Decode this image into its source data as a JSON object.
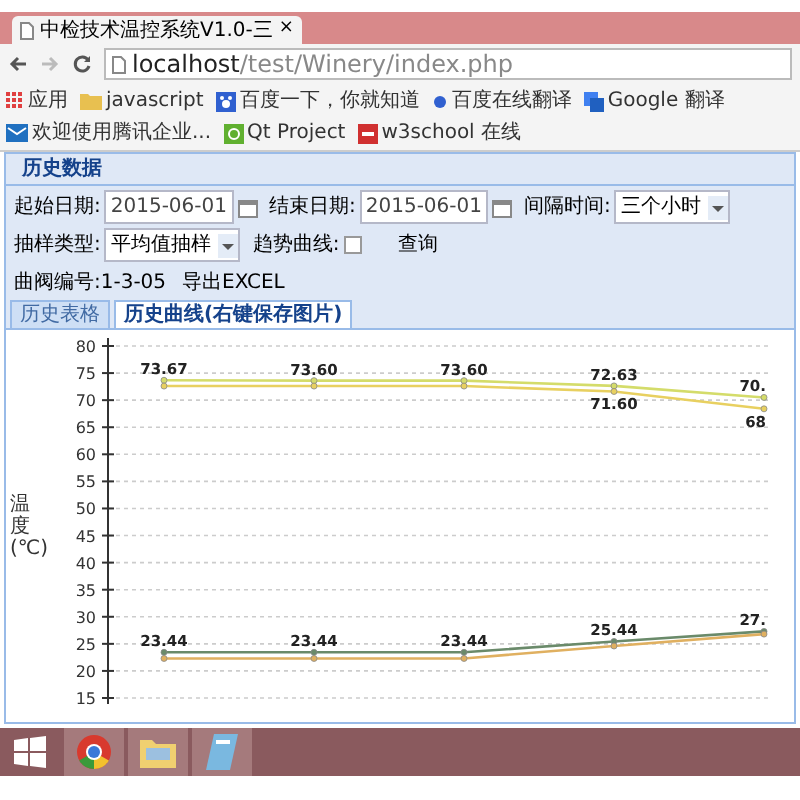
{
  "browser": {
    "tab_title": "中检技术温控系统V1.0-三",
    "tab_close": "×",
    "url_host": "localhost",
    "url_path": "/test/Winery/index.php",
    "bookmarks": [
      {
        "kind": "apps",
        "label": "应用"
      },
      {
        "kind": "folder",
        "label": "javascript"
      },
      {
        "kind": "paw",
        "label": "百度一下，你就知道"
      },
      {
        "kind": "dot",
        "label": "百度在线翻译"
      },
      {
        "kind": "translate",
        "label": "Google 翻译"
      },
      {
        "kind": "mail",
        "label": "欢迎使用腾讯企业..."
      },
      {
        "kind": "qt",
        "label": "Qt Project"
      },
      {
        "kind": "w3",
        "label": "w3school 在线"
      }
    ]
  },
  "panel": {
    "title": "历史数据",
    "filters": [
      {
        "kind": "date",
        "label": "起始日期:",
        "value": "2015-06-01"
      },
      {
        "kind": "date",
        "label": "结束日期:",
        "value": "2015-06-01"
      },
      {
        "kind": "select",
        "label": "间隔时间:",
        "value": "三个小时"
      },
      {
        "kind": "select",
        "label": "抽样类型:",
        "value": "平均值抽样"
      },
      {
        "kind": "checkbox",
        "label": "趋势曲线:",
        "checked": false
      },
      {
        "kind": "button",
        "label": "查询"
      }
    ],
    "info": "曲阀编号:1-3-05",
    "export_link": "导出EXCEL",
    "tabs": [
      {
        "label": "历史表格",
        "selected": false
      },
      {
        "label": "历史曲线(右键保存图片)",
        "selected": true
      }
    ],
    "chart_data": {
      "type": "line",
      "ylabel": "温度(℃)",
      "ylim": [
        15,
        80
      ],
      "yticks": [
        15,
        20,
        25,
        30,
        35,
        40,
        45,
        50,
        55,
        60,
        65,
        70,
        75,
        80
      ],
      "grid": true,
      "series": [
        {
          "color": "#d4dc6a",
          "marker": "circle",
          "values": [
            73.67,
            73.6,
            73.6,
            72.63,
            70.5
          ]
        },
        {
          "color": "#e8d060",
          "marker": "circle",
          "values": [
            72.6,
            72.6,
            72.6,
            71.6,
            68.4
          ]
        },
        {
          "color": "#6a8a6a",
          "marker": "circle",
          "values": [
            23.44,
            23.44,
            23.44,
            25.44,
            27.3
          ]
        },
        {
          "color": "#e0b060",
          "marker": "circle",
          "values": [
            22.3,
            22.3,
            22.3,
            24.6,
            26.8
          ]
        }
      ],
      "value_labels": [
        [
          "73.67",
          "73.60",
          "73.60",
          "72.63",
          "70."
        ],
        [
          null,
          null,
          null,
          "71.60",
          "68"
        ],
        [
          "23.44",
          "23.44",
          "23.44",
          "25.44",
          "27."
        ],
        [
          null,
          null,
          null,
          null,
          null
        ]
      ]
    }
  },
  "taskbar": [
    {
      "kind": "start"
    },
    {
      "kind": "browser"
    },
    {
      "kind": "folder"
    },
    {
      "kind": "app"
    }
  ]
}
